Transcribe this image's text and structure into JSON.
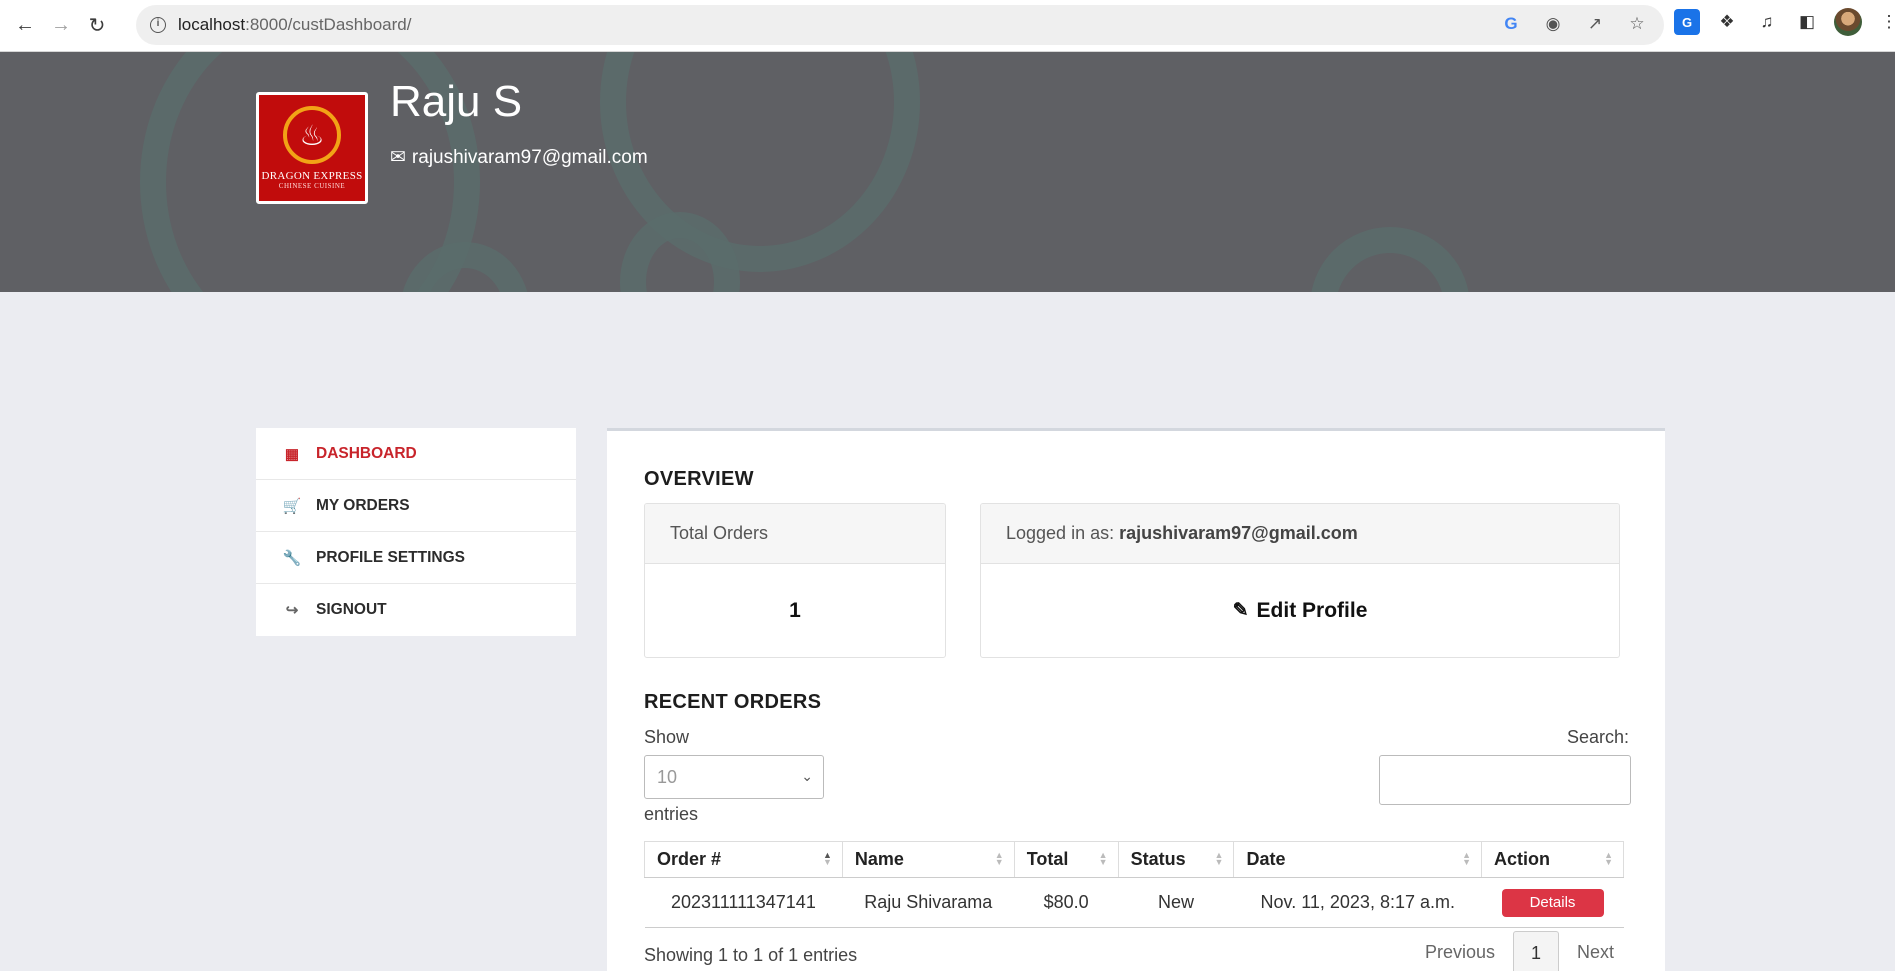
{
  "browser": {
    "url_host": "localhost",
    "url_rest": ":8000/custDashboard/"
  },
  "hero": {
    "user_name": "Raju S",
    "user_email": "rajushivaram97@gmail.com",
    "logo_brand": "DRAGON EXPRESS",
    "logo_sub": "CHINESE CUISINE"
  },
  "sidebar": {
    "items": [
      {
        "label": "DASHBOARD",
        "icon": "dashboard-icon"
      },
      {
        "label": "MY ORDERS",
        "icon": "cart-icon"
      },
      {
        "label": "PROFILE SETTINGS",
        "icon": "wrench-icon"
      },
      {
        "label": "SIGNOUT",
        "icon": "signout-icon"
      }
    ]
  },
  "overview": {
    "title": "OVERVIEW",
    "total_orders_label": "Total Orders",
    "total_orders_value": "1",
    "logged_in_label": "Logged in as:",
    "logged_in_email": "rajushivaram97@gmail.com",
    "edit_profile_label": "Edit Profile"
  },
  "recent_orders": {
    "title": "RECENT ORDERS",
    "show_label": "Show",
    "page_size": "10",
    "entries_label": "entries",
    "search_label": "Search:",
    "columns": [
      "Order #",
      "Name",
      "Total",
      "Status",
      "Date",
      "Action"
    ],
    "rows": [
      {
        "order_no": "202311111347141",
        "name": "Raju Shivarama",
        "total": "$80.0",
        "status": "New",
        "date": "Nov. 11, 2023, 8:17 a.m.",
        "action": "Details"
      }
    ],
    "info": "Showing 1 to 1 of 1 entries",
    "pager": {
      "previous": "Previous",
      "current": "1",
      "next": "Next"
    }
  }
}
